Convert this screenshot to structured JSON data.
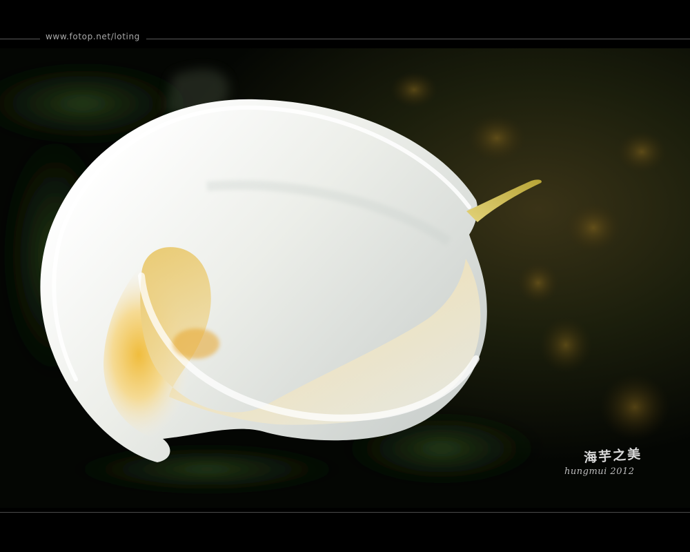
{
  "header": {
    "site_url": "www.fotop.net/loting"
  },
  "photo": {
    "subject_icon": "calla-lily-icon",
    "colors": {
      "background": "#000000",
      "petal": "#f2f3f0",
      "throat": "#e8b52a",
      "foliage": "#1f3315"
    }
  },
  "watermark": {
    "chinese_title": "海芋之美",
    "signature": "hungmui 2012"
  }
}
